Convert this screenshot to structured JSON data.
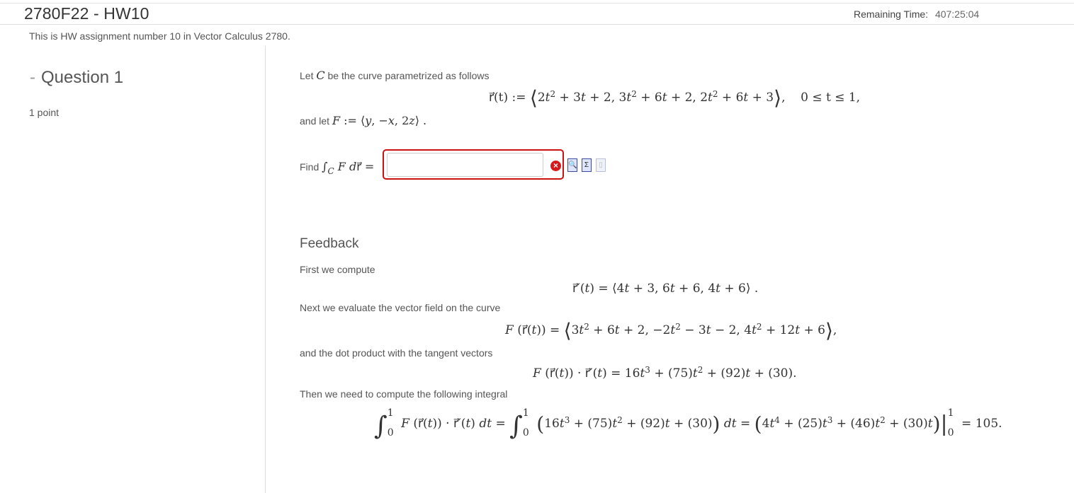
{
  "header": {
    "title": "2780F22 - HW10",
    "remaining_label": "Remaining Time:",
    "remaining_value": "407:25:04"
  },
  "description": "This is HW assignment number 10 in Vector Calculus 2780.",
  "question": {
    "dash": "-",
    "title": "Question 1",
    "points": "1 point",
    "intro": "Let",
    "intro_rest": "be the curve parametrized as follows",
    "curve_lhs": "r⃗(t) :=",
    "curve_range": "0 ≤ t ≤ 1,",
    "field_text": "and let",
    "find_text": "Find",
    "answer": {
      "value": "",
      "placeholder": ""
    }
  },
  "feedback": {
    "title": "Feedback",
    "line1": "First we compute",
    "line2": "Next we evaluate the vector field on the curve",
    "line3": "and the dot product with the tangent vectors",
    "line4": "Then we need to compute the following integral",
    "result": "= 105."
  },
  "colors": {
    "error": "#cc1111",
    "text": "#555555",
    "title": "#333333"
  },
  "icons": [
    "error-icon",
    "preview-icon",
    "equation-editor-icon",
    "paste-icon"
  ]
}
